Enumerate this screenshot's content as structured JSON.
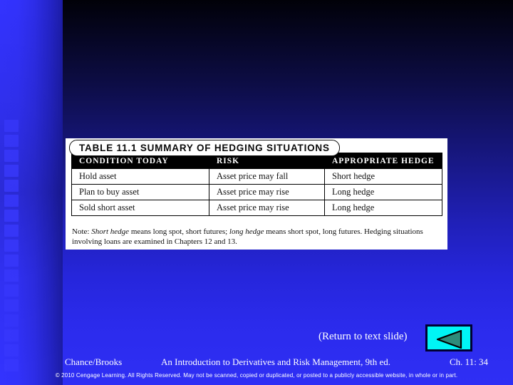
{
  "slide": {
    "background_top_color": "#000010",
    "background_bottom_color": "#3030f5",
    "stripe_color": "#3333ff"
  },
  "table": {
    "title": "TABLE 11.1   SUMMARY OF HEDGING SITUATIONS",
    "headers": [
      "CONDITION TODAY",
      "RISK",
      "APPROPRIATE HEDGE"
    ],
    "rows": [
      [
        "Hold asset",
        "Asset price may fall",
        "Short hedge"
      ],
      [
        "Plan to buy asset",
        "Asset price may rise",
        "Long hedge"
      ],
      [
        "Sold short asset",
        "Asset price may rise",
        "Long hedge"
      ]
    ],
    "note": {
      "prefix": "Note: ",
      "italic_1": "Short hedge",
      "mid_1": " means long spot, short futures; ",
      "italic_2": "long hedge",
      "mid_2": " means short spot, long futures. Hedging situations involving loans are examined in Chapters 12 and 13."
    }
  },
  "navigation": {
    "return_label": "(Return to text slide)",
    "back_button_icon": "left-triangle-icon",
    "back_button_fill": "#00f5f5",
    "back_button_border": "#000033"
  },
  "footer": {
    "author": "Chance/Brooks",
    "book_title": "An Introduction to Derivatives and Risk Management, 9th ed.",
    "chapter": "Ch. 11:  34",
    "copyright": "© 2010 Cengage Learning. All Rights Reserved. May not be scanned, copied or duplicated, or posted to a publicly accessible website, in whole or in part."
  }
}
